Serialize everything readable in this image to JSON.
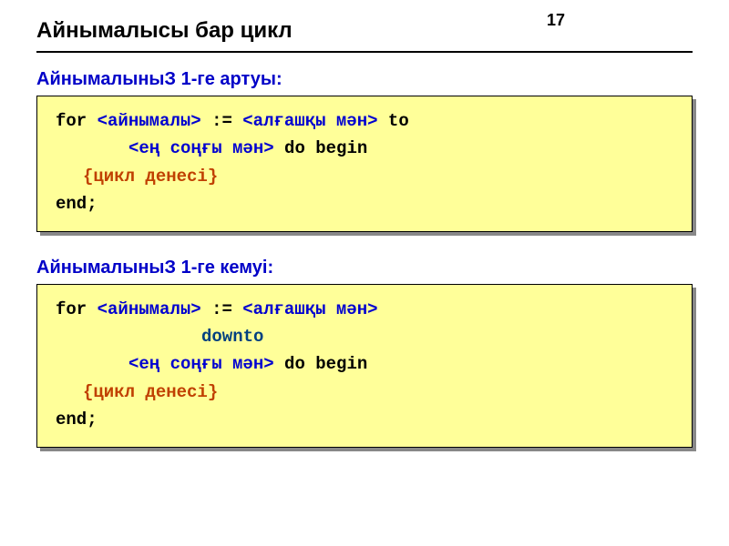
{
  "page_number": "17",
  "title": "Айнымалысы бар цикл",
  "section1": {
    "heading": "АйнымалыныЗ 1-ге артуы:",
    "code": {
      "for": "for",
      "var": "<айнымалы>",
      "assign": ":=",
      "init": "<алғашқы мән>",
      "to": "to",
      "end_val": "<ең соңғы мән>",
      "do_begin": "do begin",
      "body": "{цикл денесі}",
      "end": "end;"
    }
  },
  "section2": {
    "heading": "АйнымалыныЗ 1-ге кемуі:",
    "code": {
      "for": "for",
      "var": "<айнымалы>",
      "assign": ":=",
      "init": "<алғашқы мән>",
      "downto": "downto",
      "end_val": "<ең соңғы мән>",
      "do_begin": "do begin",
      "body": "{цикл денесі}",
      "end": "end;"
    }
  }
}
